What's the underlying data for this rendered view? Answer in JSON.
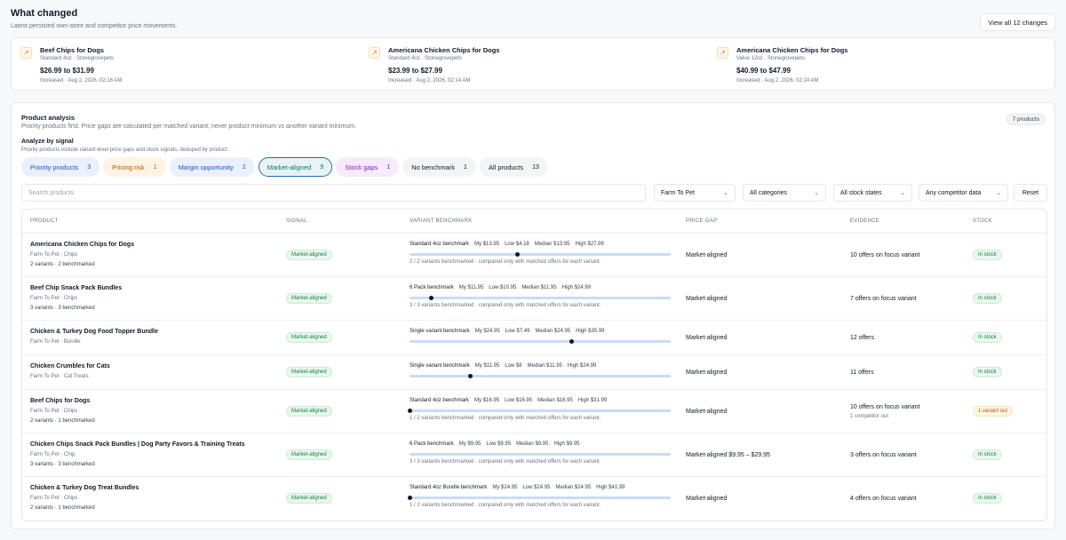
{
  "header": {
    "title": "What changed",
    "subtitle": "Latest persisted own-store and competitor price movements.",
    "view_all_label": "View all 12 changes"
  },
  "changes": [
    {
      "name": "Beef Chips for Dogs",
      "variant": "Standard 4oz · Stonegrovepets",
      "price": "$26.99 to $31.99",
      "meta": "Increased · Aug 2, 2026, 02:16 AM",
      "icon": "arrow-up-right-icon"
    },
    {
      "name": "Americana Chicken Chips for Dogs",
      "variant": "Standard 4oz · Stonegrovepets",
      "price": "$23.99 to $27.99",
      "meta": "Increased · Aug 2, 2026, 02:14 AM",
      "icon": "arrow-up-right-icon"
    },
    {
      "name": "Americana Chicken Chips for Dogs",
      "variant": "Value 12oz · Stonegrovepets",
      "price": "$40.99 to $47.99",
      "meta": "Increased · Aug 2, 2026, 02:14 AM",
      "icon": "arrow-up-right-icon"
    }
  ],
  "analysis": {
    "title": "Product analysis",
    "desc": "Priority products first. Price gaps are calculated per matched variant, never product minimum vs another variant minimum.",
    "count_badge": "7 products",
    "signal_title": "Analyze by signal",
    "signal_desc": "Priority products include variant-level price gaps and stock signals, deduped by product.",
    "pills": [
      {
        "label": "Priority products",
        "count": "3"
      },
      {
        "label": "Pricing risk",
        "count": "1"
      },
      {
        "label": "Margin opportunity",
        "count": "2"
      },
      {
        "label": "Market-aligned",
        "count": "9"
      },
      {
        "label": "Stock gaps",
        "count": "1"
      },
      {
        "label": "No benchmark",
        "count": "1"
      },
      {
        "label": "All products",
        "count": "13"
      }
    ],
    "search_placeholder": "Search products",
    "filters": {
      "store": "Farm To Pet",
      "category": "All categories",
      "stock": "All stock states",
      "competitor": "Any competitor data",
      "reset": "Reset"
    }
  },
  "table": {
    "headers": {
      "product": "PRODUCT",
      "signal": "SIGNAL",
      "benchmark": "VARIANT BENCHMARK",
      "gap": "PRICE GAP",
      "evidence": "EVIDENCE",
      "stock": "STOCK"
    },
    "rows": [
      {
        "name": "Americana Chicken Chips for Dogs",
        "meta": "Farm To Pet · Chips",
        "sub": "2 variants · 2 benchmarked",
        "signal": "Market-aligned",
        "bench": "Standard 4oz benchmark",
        "my": "My $13.95",
        "low": "Low $4.18",
        "median": "Median $13.95",
        "high": "High $27.99",
        "position": 0.41,
        "note": "2 / 2 variants benchmarked · compared only with matched offers for each variant.",
        "gap": "Market-aligned",
        "evidence": "10 offers on focus variant",
        "evidence_sub": "",
        "stock": "In stock",
        "stock_type": "green"
      },
      {
        "name": "Beef Chip Snack Pack Bundles",
        "meta": "Farm To Pet · Chips",
        "sub": "3 variants · 3 benchmarked",
        "signal": "Market-aligned",
        "bench": "6 Pack benchmark",
        "my": "My $11.95",
        "low": "Low $10.95",
        "median": "Median $11.95",
        "high": "High $24.99",
        "position": 0.08,
        "note": "3 / 3 variants benchmarked · compared only with matched offers for each variant.",
        "gap": "Market-aligned",
        "evidence": "7 offers on focus variant",
        "evidence_sub": "",
        "stock": "In stock",
        "stock_type": "green"
      },
      {
        "name": "Chicken & Turkey Dog Food Topper Bundle",
        "meta": "Farm To Pet · Bundle",
        "sub": "",
        "signal": "Market-aligned",
        "bench": "Single variant benchmark",
        "my": "My $24.95",
        "low": "Low $7.49",
        "median": "Median $24.95",
        "high": "High $35.99",
        "position": 0.62,
        "note": "",
        "gap": "Market-aligned",
        "evidence": "12 offers",
        "evidence_sub": "",
        "stock": "In stock",
        "stock_type": "green"
      },
      {
        "name": "Chicken Crumbles for Cats",
        "meta": "Farm To Pet · Cat Treats",
        "sub": "",
        "signal": "Market-aligned",
        "bench": "Single variant benchmark",
        "my": "My $11.95",
        "low": "Low $8",
        "median": "Median $11.95",
        "high": "High $24.99",
        "position": 0.23,
        "note": "",
        "gap": "Market-aligned",
        "evidence": "11 offers",
        "evidence_sub": "",
        "stock": "In stock",
        "stock_type": "green"
      },
      {
        "name": "Beef Chips for Dogs",
        "meta": "Farm To Pet · Chips",
        "sub": "2 variants · 1 benchmarked",
        "signal": "Market-aligned",
        "bench": "Standard 4oz benchmark",
        "my": "My $16.95",
        "low": "Low $16.95",
        "median": "Median $16.95",
        "high": "High $31.99",
        "position": 0.0,
        "note": "1 / 2 variants benchmarked · compared only with matched offers for each variant.",
        "gap": "Market-aligned",
        "evidence": "10 offers on focus variant",
        "evidence_sub": "1 competitor out",
        "stock": "1 variant out",
        "stock_type": "amber"
      },
      {
        "name": "Chicken Chips Snack Pack Bundles | Dog Party Favors & Training Treats",
        "meta": "Farm To Pet · Chip",
        "sub": "3 variants · 3 benchmarked",
        "signal": "Market-aligned",
        "bench": "6 Pack benchmark",
        "my": "My $9.95",
        "low": "Low $9.95",
        "median": "Median $9.95",
        "high": "High $9.95",
        "position": null,
        "note": "3 / 3 variants benchmarked · compared only with matched offers for each variant.",
        "gap": "Market-aligned $9.95 – $29.95",
        "evidence": "3 offers on focus variant",
        "evidence_sub": "",
        "stock": "In stock",
        "stock_type": "green"
      },
      {
        "name": "Chicken & Turkey Dog Treat Bundles",
        "meta": "Farm To Pet · Chips",
        "sub": "2 variants · 1 benchmarked",
        "signal": "Market-aligned",
        "bench": "Standard 4oz Bundle benchmark",
        "my": "My $24.95",
        "low": "Low $24.95",
        "median": "Median $24.95",
        "high": "High $41.99",
        "position": 0.0,
        "note": "1 / 2 variants benchmarked · compared only with matched offers for each variant.",
        "gap": "Market-aligned",
        "evidence": "4 offers on focus variant",
        "evidence_sub": "",
        "stock": "In stock",
        "stock_type": "green"
      }
    ]
  }
}
